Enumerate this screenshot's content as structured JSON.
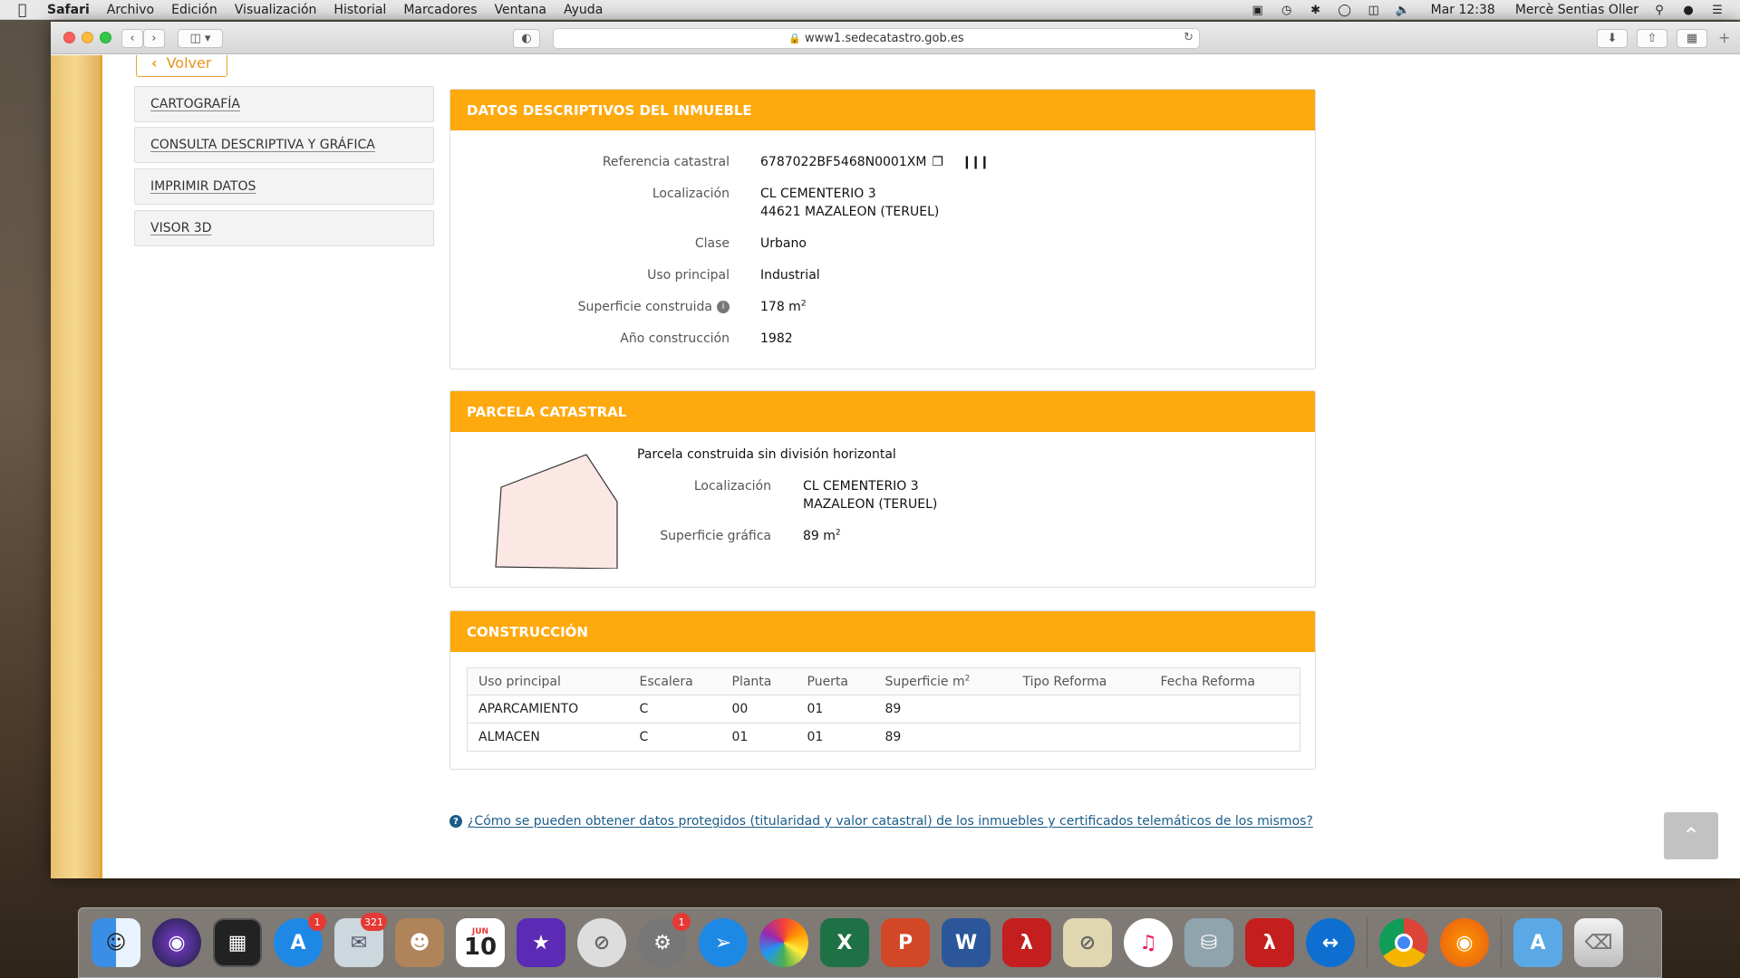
{
  "menubar": {
    "app": "Safari",
    "items": [
      "Archivo",
      "Edición",
      "Visualización",
      "Historial",
      "Marcadores",
      "Ventana",
      "Ayuda"
    ],
    "clock": "Mar 12:38",
    "user": "Mercè Sentias Oller"
  },
  "browser": {
    "url": "www1.sedecatastro.gob.es"
  },
  "page": {
    "back_label": "Volver",
    "sidebar": [
      "CARTOGRAFÍA",
      "CONSULTA DESCRIPTIVA Y GRÁFICA",
      "IMPRIMIR DATOS",
      "VISOR 3D"
    ],
    "datos": {
      "title": "DATOS DESCRIPTIVOS DEL INMUEBLE",
      "ref_label": "Referencia catastral",
      "ref_value": "6787022BF5468N0001XM",
      "loc_label": "Localización",
      "loc_line1": "CL CEMENTERIO 3",
      "loc_line2": "44621 MAZALEON (TERUEL)",
      "clase_label": "Clase",
      "clase_value": "Urbano",
      "uso_label": "Uso principal",
      "uso_value": "Industrial",
      "sup_label": "Superficie construida",
      "sup_value": "178 m",
      "sup_exp": "2",
      "anio_label": "Año construcción",
      "anio_value": "1982"
    },
    "parcela": {
      "title": "PARCELA CATASTRAL",
      "desc": "Parcela construida sin división horizontal",
      "loc_label": "Localización",
      "loc_line1": "CL CEMENTERIO 3",
      "loc_line2": "MAZALEON (TERUEL)",
      "sup_label": "Superficie gráfica",
      "sup_value": "89 m",
      "sup_exp": "2"
    },
    "construccion": {
      "title": "CONSTRUCCIÓN",
      "headers": [
        "Uso principal",
        "Escalera",
        "Planta",
        "Puerta",
        "Superficie m",
        "Tipo Reforma",
        "Fecha Reforma"
      ],
      "sup_exp": "2",
      "rows": [
        [
          "APARCAMIENTO",
          "C",
          "00",
          "01",
          "89",
          "",
          ""
        ],
        [
          "ALMACEN",
          "C",
          "01",
          "01",
          "89",
          "",
          ""
        ]
      ]
    },
    "faq": "¿Cómo se pueden obtener datos protegidos (titularidad y valor catastral) de los inmuebles y certificados telemáticos de los mismos?"
  },
  "dock": {
    "badges": {
      "appstore": "1",
      "mail": "321",
      "prefs": "1"
    },
    "calendar_month": "JUN",
    "calendar_day": "10"
  },
  "colors": {
    "accent": "#fea90e",
    "link": "#1a5c8a"
  }
}
